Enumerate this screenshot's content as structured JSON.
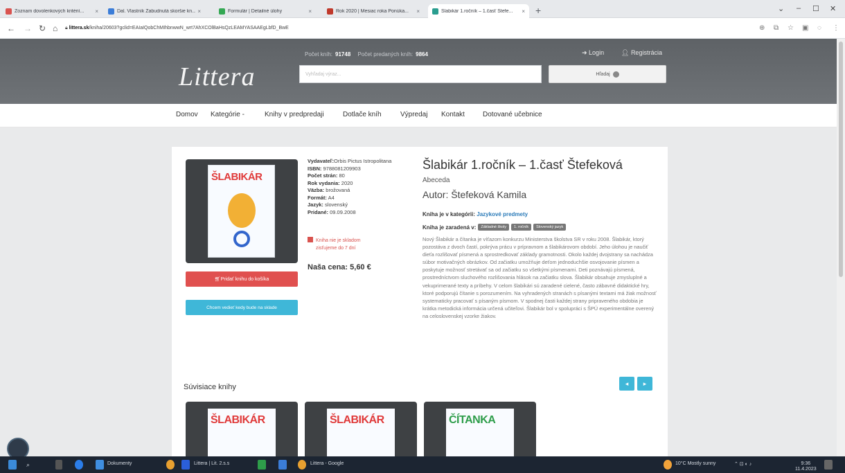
{
  "browser": {
    "tabs": [
      {
        "label": "Zoznam dovolenkových kritérií...",
        "color": "#d9534f"
      },
      {
        "label": "Ďal. Vlastník Zabudnutá skoršie kn...",
        "color": "#3b7dd8"
      },
      {
        "label": "Formulár | Detailné úlohy",
        "color": "#34a853"
      },
      {
        "label": "Rok 2020 | Mesiac roka Ponúka...",
        "color": "#c0392b"
      },
      {
        "label": "Šlabikár 1.ročník – 1.časť Štefe...",
        "color": "#2a9d8f"
      }
    ],
    "url_host": "littera.sk",
    "url_rest": "/kniha/20603?gclid=EAIaIQobChMIhbnwwN_wrt7AhXCOlBaHsQzLEAMYASAAEgLbfD_BwE"
  },
  "header": {
    "stats_label_1": "Počet kníh:",
    "stats_value_1": "91748",
    "stats_label_2": "Počet predaných kníh:",
    "stats_value_2": "9864",
    "login": "Login",
    "register": "Registrácia",
    "logo": "Littera",
    "search_placeholder": "Vyhľadaj výraz...",
    "search_button": "Hľadaj"
  },
  "nav": [
    "Domov",
    "Kategórie -",
    "Knihy v predpredaji",
    "Dotlače kníh",
    "Výpredaj",
    "Kontakt",
    "Dotované učebnice"
  ],
  "book": {
    "cover_title": "ŠLABIKÁR",
    "meta": [
      {
        "label": "Vydavateľ:",
        "value": "Orbis Pictus Istropolitana"
      },
      {
        "label": "ISBN:",
        "value": "9788081209903"
      },
      {
        "label": "Počet strán:",
        "value": "80"
      },
      {
        "label": "Rok vydania:",
        "value": "2020"
      },
      {
        "label": "Väzba:",
        "value": "brožovaná"
      },
      {
        "label": "Formát:",
        "value": "A4"
      },
      {
        "label": "Jazyk:",
        "value": "slovenský"
      },
      {
        "label": "Pridané:",
        "value": "09.09.2008"
      }
    ],
    "availability_1": "Kniha nie je skladom",
    "availability_2": "zisťujeme do 7 dní",
    "price_label": "Naša cena: 5,60 €",
    "add_to_cart": "Pridať knihu do košíka",
    "notify": "Chcem vedieť kedy bude na sklade",
    "title": "Šlabikár 1.ročník – 1.časť Štefeková",
    "subtitle": "Abeceda",
    "author": "Autor: Štefeková Kamila",
    "category_label": "Kniha je v kategórii:",
    "category_value": "Jazykové predmety",
    "tags_label": "Kniha je zaradená v:",
    "tags": [
      "Základné školy",
      "1. ročník",
      "Slovenský jazyk"
    ],
    "description": "Nový Šlabikár a čítanka je víťazom konkurzu Ministerstva školstva SR v roku 2008. Šlabikár, ktorý pozostáva z dvoch častí, pokrýva prácu v prípravnom a šlabikárovom období. Jeho úlohou je naučiť dieťa rozlišovať písmená a sprostredkovať základy gramotnosti. Okolo každej dvojstrany sa nachádza súbor motivačných obrázkov. Od začiatku umožňuje deťom jednoduchšie osvojovanie písmen a poskytuje možnosť stretávať sa od začiatku so všetkými písmenami. Deti poznávajú písmená, prostredníctvom sluchového rozlišovania hlások na začiatku slova. Šlabikár obsahuje zmysluplné a vekuprimerané texty a príbehy. V celom šlabikári sú zaradené cielené, často zábavné didaktické hry, ktoré podporujú čítanie s porozumením. Na vyhradených stranách s písanými textami má žiak možnosť systematicky pracovať s písaným písmom. V spodnej časti každej strany pripraveného obdobia je krátka metodická informácia určená učiteľovi. Šlabikár bol v spolupráci s ŠPÚ experimentálne overený na celoslovenskej vzorke žiakov."
  },
  "related": {
    "title": "Súvisiace knihy",
    "prev": "◂",
    "next": "▸",
    "items": [
      {
        "cover_title": "ŠLABIKÁR",
        "color": "#e03a3a"
      },
      {
        "cover_title": "ŠLABIKÁR",
        "color": "#e03a3a"
      },
      {
        "cover_title": "ČÍTANKA",
        "color": "#2e9d4a"
      }
    ]
  },
  "taskbar": {
    "items": [
      "Dokumenty",
      "Littera | Lit. 2.s.s",
      "Littera - Google"
    ],
    "weather": "10°C  Mostly sunny",
    "time": "9:36",
    "date": "11.4.2023"
  }
}
